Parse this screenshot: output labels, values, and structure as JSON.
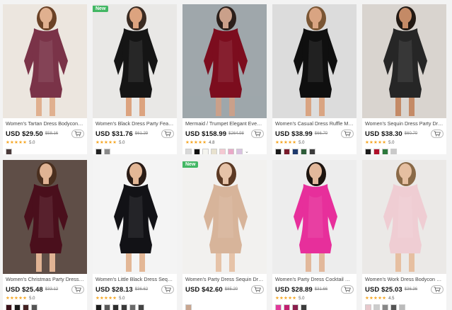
{
  "products": [
    {
      "title": "Women's Tartan Dress Bodycon Dress",
      "price": "USD $29.50",
      "old_price": "$58.16",
      "badge": "",
      "stars": "★★★★★",
      "rating": "5.0",
      "swatches": [
        "#4a3a3a"
      ],
      "more": "",
      "bg": "#ece6df",
      "dress": "#7a3348",
      "skin": "#e0b08f",
      "hair": "#6b4226"
    },
    {
      "title": "Women's Black Dress Party Feather Dress",
      "price": "USD $31.76",
      "old_price": "$61.29",
      "badge": "New",
      "stars": "★★★★★",
      "rating": "5.0",
      "swatches": [
        "#222222",
        "#8a8a8a"
      ],
      "more": "",
      "bg": "#e9e8e6",
      "dress": "#151515",
      "skin": "#dca37f",
      "hair": "#3a2b22"
    },
    {
      "title": "Mermaid / Trumpet Elegant Evening Dress",
      "price": "USD $158.99",
      "old_price": "$264.98",
      "badge": "",
      "stars": "★★★★★",
      "rating": "4.8",
      "swatches": [
        "#d8d8d8",
        "#111111",
        "#f5f5f0",
        "#e8e2cf",
        "#f4c9d2",
        "#e9a9c8",
        "#d9c2e0"
      ],
      "more": "⌄",
      "bg": "#9fa7ab",
      "dress": "#7c0d1e",
      "skin": "#caa08a",
      "hair": "#2b1f1a"
    },
    {
      "title": "Women's Casual Dress Ruffle Mini Dress",
      "price": "USD $38.99",
      "old_price": "$66.70",
      "badge": "",
      "stars": "★★★★★",
      "rating": "5.0",
      "swatches": [
        "#1a1a1a",
        "#7a1c2c",
        "#1f3b6e",
        "#2f5e3a",
        "#3c3c3c"
      ],
      "more": "",
      "bg": "#dcdcdc",
      "dress": "#0f0f0f",
      "skin": "#d9a482",
      "hair": "#7a5634"
    },
    {
      "title": "Women's Sequin Dress Party Dress",
      "price": "USD $38.30",
      "old_price": "$60.70",
      "badge": "",
      "stars": "★★★★★",
      "rating": "5.0",
      "swatches": [
        "#1c1c1c",
        "#b0102a",
        "#2d7a3e",
        "#c9c9c9"
      ],
      "more": "",
      "bg": "#d9d4cf",
      "dress": "#262626",
      "skin": "#c48a66",
      "hair": "#221913"
    },
    {
      "title": "Women's Christmas Party Dress Velvet",
      "price": "USD $25.48",
      "old_price": "$33.12",
      "badge": "",
      "stars": "★★★★★",
      "rating": "5.0",
      "swatches": [
        "#3b1018",
        "#1a1a1a",
        "#442222",
        "#555555"
      ],
      "more": "",
      "bg": "#5f4e47",
      "dress": "#4a0f1c",
      "skin": "#e0b394",
      "hair": "#4a2f1f"
    },
    {
      "title": "Women's Little Black Dress Sequin Dress",
      "price": "USD $28.13",
      "old_price": "$36.62",
      "badge": "",
      "stars": "★★★★★",
      "rating": "5.0",
      "swatches": [
        "#1c1c1c",
        "#5a5a5a",
        "#2e2e2e",
        "#3a3a3a",
        "#6a6a6a",
        "#444444"
      ],
      "more": "",
      "bg": "#f4f4f4",
      "dress": "#121216",
      "skin": "#e3b796",
      "hair": "#2a1c16"
    },
    {
      "title": "Women's Party Dress Sequin Dress",
      "price": "USD $42.60",
      "old_price": "$85.20",
      "badge": "New",
      "stars": "",
      "rating": "",
      "swatches": [
        "#c9a690"
      ],
      "more": "",
      "bg": "#f2f1ef",
      "dress": "#d7b49a",
      "skin": "#e6c3a8",
      "hair": "#5c3a24"
    },
    {
      "title": "Women's Party Dress Cocktail Dress",
      "price": "USD $28.89",
      "old_price": "$31.66",
      "badge": "",
      "stars": "★★★★★",
      "rating": "5.0",
      "swatches": [
        "#e23a9c",
        "#c02070",
        "#8a1f4d",
        "#3c3c3c"
      ],
      "more": "",
      "bg": "#ededed",
      "dress": "#e72f9b",
      "skin": "#e2b89b",
      "hair": "#1e1510"
    },
    {
      "title": "Women's Work Dress Bodycon Dress",
      "price": "USD $25.03",
      "old_price": "$36.36",
      "badge": "",
      "stars": "★★★★★",
      "rating": "4.5",
      "swatches": [
        "#e8c8cc",
        "#cccccc",
        "#888888",
        "#555555",
        "#bbbbbb"
      ],
      "more": "",
      "bg": "#ebe9e7",
      "dress": "#efcdd3",
      "skin": "#e6bfa1",
      "hair": "#8a6a48"
    }
  ]
}
